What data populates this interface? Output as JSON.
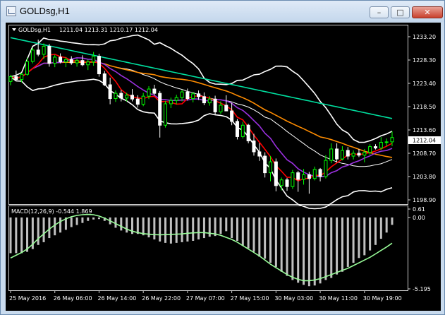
{
  "window": {
    "title": "GOLDsg,H1",
    "icons": {
      "app": "chart-app-icon",
      "minimize": "minimize-icon",
      "restore": "restore-icon",
      "close": "close-icon"
    },
    "glyphs": {
      "minimize": "–",
      "restore": "□",
      "close": "✕"
    }
  },
  "chart_data": [
    {
      "type": "candlestick",
      "symbol": "GOLDsg",
      "timeframe": "H1",
      "title": "GOLDsg,H1",
      "ohlc_header": "1211.04 1213.31 1210.17 1212.04",
      "current_price": "1212.04",
      "y_ticks": [
        "1233.20",
        "1228.30",
        "1223.40",
        "1218.50",
        "1213.60",
        "1208.70",
        "1203.80",
        "1198.90"
      ],
      "ylim": [
        1198.9,
        1233.2
      ],
      "x_ticks": [
        "25 May 2016",
        "26 May 06:00",
        "26 May 14:00",
        "26 May 22:00",
        "27 May 07:00",
        "27 May 15:00",
        "30 May 03:00",
        "30 May 11:00",
        "30 May 19:00"
      ],
      "candles": [
        [
          1223.8,
          1225.2,
          1223.0,
          1224.8
        ],
        [
          1224.8,
          1226.1,
          1223.9,
          1224.2
        ],
        [
          1224.2,
          1225.6,
          1223.6,
          1225.3
        ],
        [
          1225.3,
          1228.8,
          1225.0,
          1228.0
        ],
        [
          1228.0,
          1230.9,
          1227.6,
          1230.4
        ],
        [
          1230.4,
          1232.6,
          1229.1,
          1229.5
        ],
        [
          1229.5,
          1231.8,
          1228.5,
          1231.2
        ],
        [
          1231.2,
          1231.7,
          1226.9,
          1227.6
        ],
        [
          1227.6,
          1229.4,
          1226.8,
          1228.9
        ],
        [
          1228.9,
          1229.7,
          1227.6,
          1227.9
        ],
        [
          1227.9,
          1228.9,
          1226.8,
          1228.4
        ],
        [
          1228.4,
          1229.1,
          1227.3,
          1227.7
        ],
        [
          1227.7,
          1228.6,
          1226.9,
          1228.2
        ],
        [
          1228.2,
          1229.3,
          1227.0,
          1227.3
        ],
        [
          1227.3,
          1228.4,
          1226.2,
          1227.9
        ],
        [
          1227.9,
          1230.0,
          1227.1,
          1229.1
        ],
        [
          1229.1,
          1229.6,
          1224.8,
          1225.4
        ],
        [
          1225.4,
          1226.0,
          1222.8,
          1223.1
        ],
        [
          1223.1,
          1224.6,
          1219.0,
          1220.2
        ],
        [
          1220.2,
          1221.9,
          1219.5,
          1221.3
        ],
        [
          1221.3,
          1222.0,
          1219.6,
          1220.3
        ],
        [
          1220.3,
          1221.4,
          1219.6,
          1220.9
        ],
        [
          1220.9,
          1222.2,
          1219.6,
          1220.1
        ],
        [
          1220.1,
          1220.9,
          1218.3,
          1219.0
        ],
        [
          1219.0,
          1221.4,
          1218.6,
          1220.7
        ],
        [
          1220.7,
          1222.8,
          1220.1,
          1222.2
        ],
        [
          1222.2,
          1223.1,
          1220.9,
          1221.3
        ],
        [
          1221.3,
          1221.8,
          1212.0,
          1214.6
        ],
        [
          1214.6,
          1219.7,
          1214.1,
          1219.1
        ],
        [
          1219.1,
          1220.4,
          1218.2,
          1219.8
        ],
        [
          1219.8,
          1221.0,
          1219.0,
          1220.4
        ],
        [
          1220.4,
          1222.0,
          1219.6,
          1221.6
        ],
        [
          1221.6,
          1222.3,
          1219.8,
          1220.2
        ],
        [
          1220.2,
          1221.6,
          1219.4,
          1221.2
        ],
        [
          1221.2,
          1221.9,
          1219.9,
          1220.6
        ],
        [
          1220.6,
          1221.5,
          1218.8,
          1219.3
        ],
        [
          1219.3,
          1220.7,
          1218.7,
          1220.1
        ],
        [
          1220.1,
          1220.8,
          1216.8,
          1217.4
        ],
        [
          1217.4,
          1219.6,
          1217.0,
          1218.8
        ],
        [
          1218.8,
          1220.9,
          1218.3,
          1217.6
        ],
        [
          1217.6,
          1219.3,
          1214.6,
          1215.4
        ],
        [
          1215.4,
          1215.9,
          1211.6,
          1212.2
        ],
        [
          1212.2,
          1215.3,
          1211.8,
          1214.6
        ],
        [
          1214.6,
          1214.9,
          1210.8,
          1211.3
        ],
        [
          1211.3,
          1212.8,
          1208.2,
          1209.0
        ],
        [
          1209.0,
          1210.8,
          1207.1,
          1208.1
        ],
        [
          1208.1,
          1208.9,
          1203.6,
          1204.6
        ],
        [
          1204.6,
          1208.1,
          1202.8,
          1206.9
        ],
        [
          1206.9,
          1207.6,
          1200.7,
          1201.9
        ],
        [
          1201.9,
          1203.6,
          1200.9,
          1203.1
        ],
        [
          1203.1,
          1203.5,
          1200.8,
          1201.7
        ],
        [
          1201.7,
          1205.2,
          1201.2,
          1204.6
        ],
        [
          1204.6,
          1205.0,
          1200.6,
          1203.2
        ],
        [
          1203.2,
          1205.4,
          1202.1,
          1204.2
        ],
        [
          1204.2,
          1204.8,
          1200.2,
          1203.4
        ],
        [
          1203.4,
          1205.9,
          1203.0,
          1205.3
        ],
        [
          1205.3,
          1205.6,
          1202.8,
          1203.8
        ],
        [
          1203.8,
          1208.3,
          1203.4,
          1207.2
        ],
        [
          1207.2,
          1210.8,
          1206.6,
          1209.6
        ],
        [
          1209.6,
          1210.8,
          1206.8,
          1207.5
        ],
        [
          1207.5,
          1210.2,
          1207.2,
          1209.3
        ],
        [
          1209.3,
          1210.0,
          1207.4,
          1208.1
        ],
        [
          1208.1,
          1209.3,
          1207.4,
          1208.7
        ],
        [
          1208.7,
          1209.6,
          1207.9,
          1208.3
        ],
        [
          1208.3,
          1209.6,
          1206.8,
          1208.9
        ],
        [
          1208.9,
          1210.6,
          1208.4,
          1210.1
        ],
        [
          1210.1,
          1210.6,
          1209.5,
          1209.8
        ],
        [
          1209.8,
          1212.1,
          1209.4,
          1211.0
        ],
        [
          1211.0,
          1211.8,
          1210.2,
          1211.1
        ],
        [
          1211.1,
          1213.3,
          1210.2,
          1212.0
        ]
      ],
      "colors": {
        "background": "#000000",
        "bull_candle": "#00ff00",
        "bear_candle": "#ffffff",
        "ma_fast": "#ff0000",
        "ma_mid": "#9b30e0",
        "ma_slow": "#ff8c00",
        "ma_long": "#00e0a0",
        "bands": "#ffffff",
        "grid": "#333333"
      }
    },
    {
      "type": "bar",
      "indicator": "MACD(12,26,9)",
      "label": "MACD(12,26,9) -0.544 1.869",
      "y_ticks": [
        "0.61",
        "0.00",
        "-5.195"
      ],
      "ylim": [
        -5.195,
        0.61
      ],
      "histogram": [
        -2.6,
        -2.6,
        -2.6,
        -2.5,
        -2.3,
        -2.0,
        -1.8,
        -1.5,
        -1.3,
        -1.1,
        -0.9,
        -0.7,
        -0.55,
        -0.4,
        -0.25,
        -0.15,
        -0.12,
        -0.25,
        -0.5,
        -0.75,
        -0.95,
        -1.1,
        -1.2,
        -1.2,
        -1.3,
        -1.45,
        -1.6,
        -1.75,
        -1.85,
        -1.9,
        -1.85,
        -1.8,
        -1.75,
        -1.7,
        -1.6,
        -1.5,
        -1.4,
        -1.35,
        -1.2,
        -1.0,
        -1.5,
        -1.7,
        -2.05,
        -2.25,
        -2.5,
        -2.85,
        -3.0,
        -3.3,
        -3.6,
        -3.95,
        -4.25,
        -4.55,
        -4.75,
        -4.9,
        -5.0,
        -4.95,
        -4.8,
        -4.55,
        -4.4,
        -4.15,
        -3.95,
        -3.6,
        -3.3,
        -2.95,
        -2.75,
        -2.4,
        -2.0,
        -1.55,
        -1.1,
        -0.54
      ],
      "signal": [
        -2.95,
        -2.75,
        -2.55,
        -2.3,
        -1.95,
        -1.55,
        -1.2,
        -0.85,
        -0.55,
        -0.3,
        -0.1,
        0.05,
        0.15,
        0.2,
        0.22,
        0.2,
        0.1,
        -0.05,
        -0.25,
        -0.45,
        -0.65,
        -0.85,
        -1.0,
        -1.1,
        -1.18,
        -1.22,
        -1.25,
        -1.26,
        -1.25,
        -1.23,
        -1.22,
        -1.2,
        -1.15,
        -1.12,
        -1.1,
        -1.1,
        -1.15,
        -1.2,
        -1.3,
        -1.45,
        -1.6,
        -1.8,
        -2.05,
        -2.3,
        -2.55,
        -2.8,
        -3.1,
        -3.4,
        -3.65,
        -3.9,
        -4.15,
        -4.35,
        -4.5,
        -4.6,
        -4.6,
        -4.55,
        -4.45,
        -4.3,
        -4.15,
        -4.0,
        -3.85,
        -3.7,
        -3.5,
        -3.3,
        -3.1,
        -2.9,
        -2.65,
        -2.4,
        -2.15,
        -1.87
      ],
      "colors": {
        "histogram": "#c0c0c0",
        "signal": "#98fb98"
      }
    }
  ]
}
